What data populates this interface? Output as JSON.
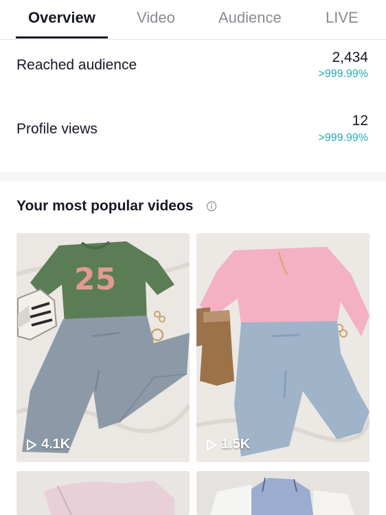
{
  "tabs": [
    {
      "label": "Overview",
      "active": true
    },
    {
      "label": "Video",
      "active": false
    },
    {
      "label": "Audience",
      "active": false
    },
    {
      "label": "LIVE",
      "active": false
    }
  ],
  "metrics": [
    {
      "label": "Reached audience",
      "value": "2,434",
      "change": ">999.99%"
    },
    {
      "label": "Profile views",
      "value": "12",
      "change": ">999.99%"
    }
  ],
  "popular": {
    "title": "Your most popular videos",
    "info_icon": "info-circle-icon",
    "videos": [
      {
        "views": "4.1K",
        "play_icon": "play-outline-icon",
        "jersey_number": "25"
      },
      {
        "views": "1.5K",
        "play_icon": "play-outline-icon"
      },
      {
        "views": ""
      },
      {
        "views": ""
      }
    ]
  },
  "colors": {
    "text": "#161823",
    "muted": "#8a8b91",
    "accent_teal": "#20aab6",
    "divider": "#f6f6f7"
  }
}
